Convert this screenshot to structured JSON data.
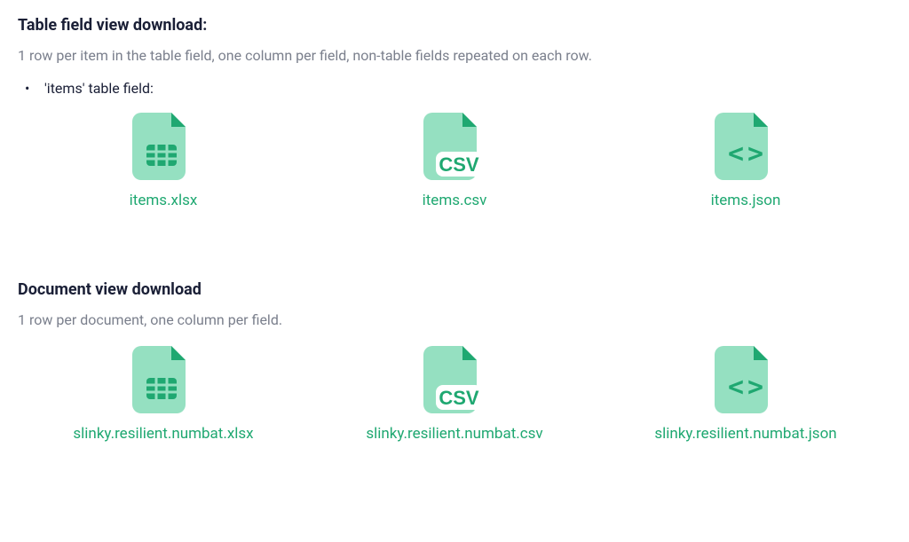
{
  "colors": {
    "accent": "#1fa871",
    "muted": "#7a7f8c",
    "text": "#1a1f36"
  },
  "section1": {
    "heading": "Table field view download:",
    "description": "1 row per item in the table field, one column per field, non-table fields repeated on each row.",
    "bullet": "'items' table field:",
    "files": [
      {
        "name": "items.xlsx",
        "type": "xlsx"
      },
      {
        "name": "items.csv",
        "type": "csv"
      },
      {
        "name": "items.json",
        "type": "json"
      }
    ]
  },
  "section2": {
    "heading": "Document view download",
    "description": "1 row per document, one column per field.",
    "files": [
      {
        "name": "slinky.resilient.numbat.xlsx",
        "type": "xlsx"
      },
      {
        "name": "slinky.resilient.numbat.csv",
        "type": "csv"
      },
      {
        "name": "slinky.resilient.numbat.json",
        "type": "json"
      }
    ]
  }
}
